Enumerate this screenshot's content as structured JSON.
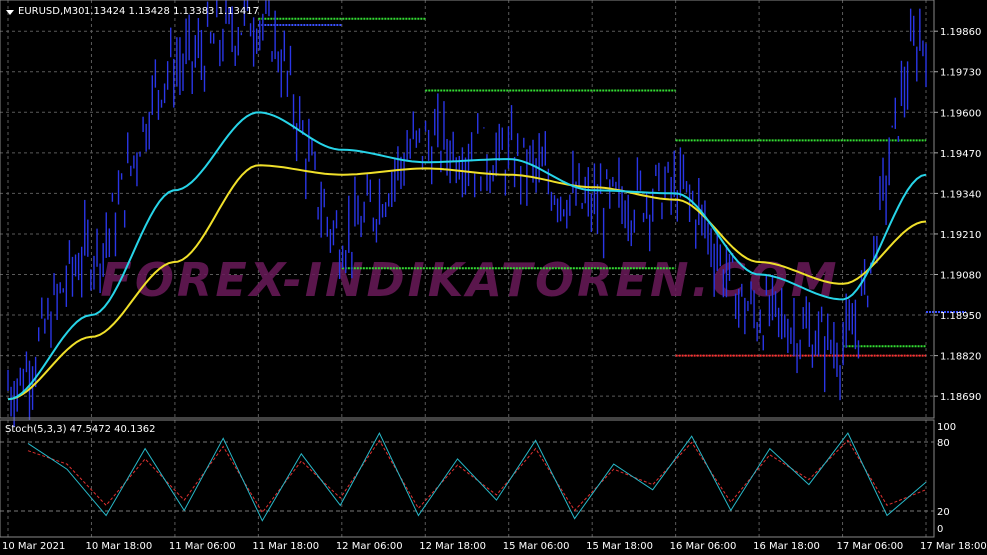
{
  "header": {
    "symbol_label": "EURUSD,M30",
    "ohlc_label": "1.13424 1.13428 1.13383 1.13417"
  },
  "watermark": "FOREX-INDIKATOREN.COM",
  "colors": {
    "background": "#000000",
    "grid": "#5a5a5a",
    "price": "#2a36e6",
    "ma_fast": "#27d4e8",
    "ma_slow": "#f0e02a",
    "level_green": "#33dd33",
    "level_blue": "#3a50ff",
    "level_red": "#ff3030",
    "stoch_main": "#27b8c8",
    "stoch_signal": "#e03030",
    "text": "#ffffff"
  },
  "price_axis": {
    "ticks": [
      "1.19860",
      "1.19730",
      "1.19600",
      "1.19470",
      "1.19340",
      "1.19210",
      "1.19080",
      "1.18950",
      "1.18820",
      "1.18690"
    ]
  },
  "time_axis": {
    "ticks": [
      "10 Mar 2021",
      "10 Mar 18:00",
      "11 Mar 06:00",
      "11 Mar 18:00",
      "12 Mar 06:00",
      "12 Mar 18:00",
      "15 Mar 06:00",
      "15 Mar 18:00",
      "16 Mar 06:00",
      "16 Mar 18:00",
      "17 Mar 06:00",
      "17 Mar 18:00"
    ]
  },
  "stoch": {
    "label": "Stoch(5,3,3) 47.5472 40.1362",
    "ticks": [
      "100",
      "80",
      "20",
      "0"
    ],
    "ylim": [
      0,
      100
    ]
  },
  "chart_data": [
    {
      "type": "line",
      "title": "EURUSD,M30",
      "ylim": [
        1.1862,
        1.1996
      ],
      "x": [
        "10 Mar 2021",
        "10 Mar 18:00",
        "11 Mar 06:00",
        "11 Mar 18:00",
        "12 Mar 06:00",
        "12 Mar 18:00",
        "15 Mar 06:00",
        "15 Mar 18:00",
        "16 Mar 06:00",
        "16 Mar 18:00",
        "17 Mar 06:00",
        "17 Mar 18:00"
      ],
      "series": [
        {
          "values": [
            1.1872,
            1.1915,
            1.1975,
            1.199,
            1.192,
            1.195,
            1.1945,
            1.193,
            1.1935,
            1.1895,
            1.1885,
            1.1985
          ]
        },
        {
          "values": [
            1.1868,
            1.1895,
            1.1935,
            1.196,
            1.1948,
            1.1944,
            1.1945,
            1.1935,
            1.1934,
            1.1908,
            1.19,
            1.194
          ]
        },
        {
          "values": [
            1.1868,
            1.1888,
            1.1912,
            1.1943,
            1.194,
            1.1942,
            1.194,
            1.1936,
            1.1932,
            1.1912,
            1.1905,
            1.1925
          ]
        }
      ],
      "levels": [
        {
          "kind": "green",
          "value": 1.199,
          "from": "11 Mar 18:00",
          "to": "12 Mar 18:00"
        },
        {
          "kind": "blue",
          "value": 1.1988,
          "from": "11 Mar 18:00",
          "to": "12 Mar 06:00"
        },
        {
          "kind": "green",
          "value": 1.1967,
          "from": "12 Mar 18:00",
          "to": "16 Mar 06:00"
        },
        {
          "kind": "green",
          "value": 1.1951,
          "from": "16 Mar 06:00",
          "to": "17 Mar 18:00"
        },
        {
          "kind": "green",
          "value": 1.191,
          "from": "12 Mar 06:00",
          "to": "16 Mar 06:00"
        },
        {
          "kind": "blue",
          "value": 1.1896,
          "from": "17 Mar 18:00",
          "to": "17 Mar 18:00"
        },
        {
          "kind": "green",
          "value": 1.1885,
          "from": "17 Mar 06:00",
          "to": "17 Mar 18:00"
        },
        {
          "kind": "red",
          "value": 1.1882,
          "from": "16 Mar 06:00",
          "to": "17 Mar 18:00"
        }
      ]
    },
    {
      "type": "line",
      "title": "Stoch(5,3,3)",
      "ylim": [
        0,
        100
      ],
      "series": [
        {
          "name": "47.5472",
          "values": [
            85,
            60,
            15,
            80,
            20,
            90,
            10,
            75,
            25,
            95,
            15,
            70,
            30,
            88,
            12,
            65,
            40,
            92,
            20,
            80,
            45,
            95,
            15,
            47.5
          ]
        },
        {
          "name": "40.1362",
          "values": [
            78,
            65,
            25,
            70,
            30,
            82,
            18,
            68,
            32,
            88,
            22,
            64,
            35,
            80,
            20,
            60,
            45,
            86,
            28,
            74,
            50,
            88,
            25,
            40.1
          ]
        }
      ]
    }
  ]
}
